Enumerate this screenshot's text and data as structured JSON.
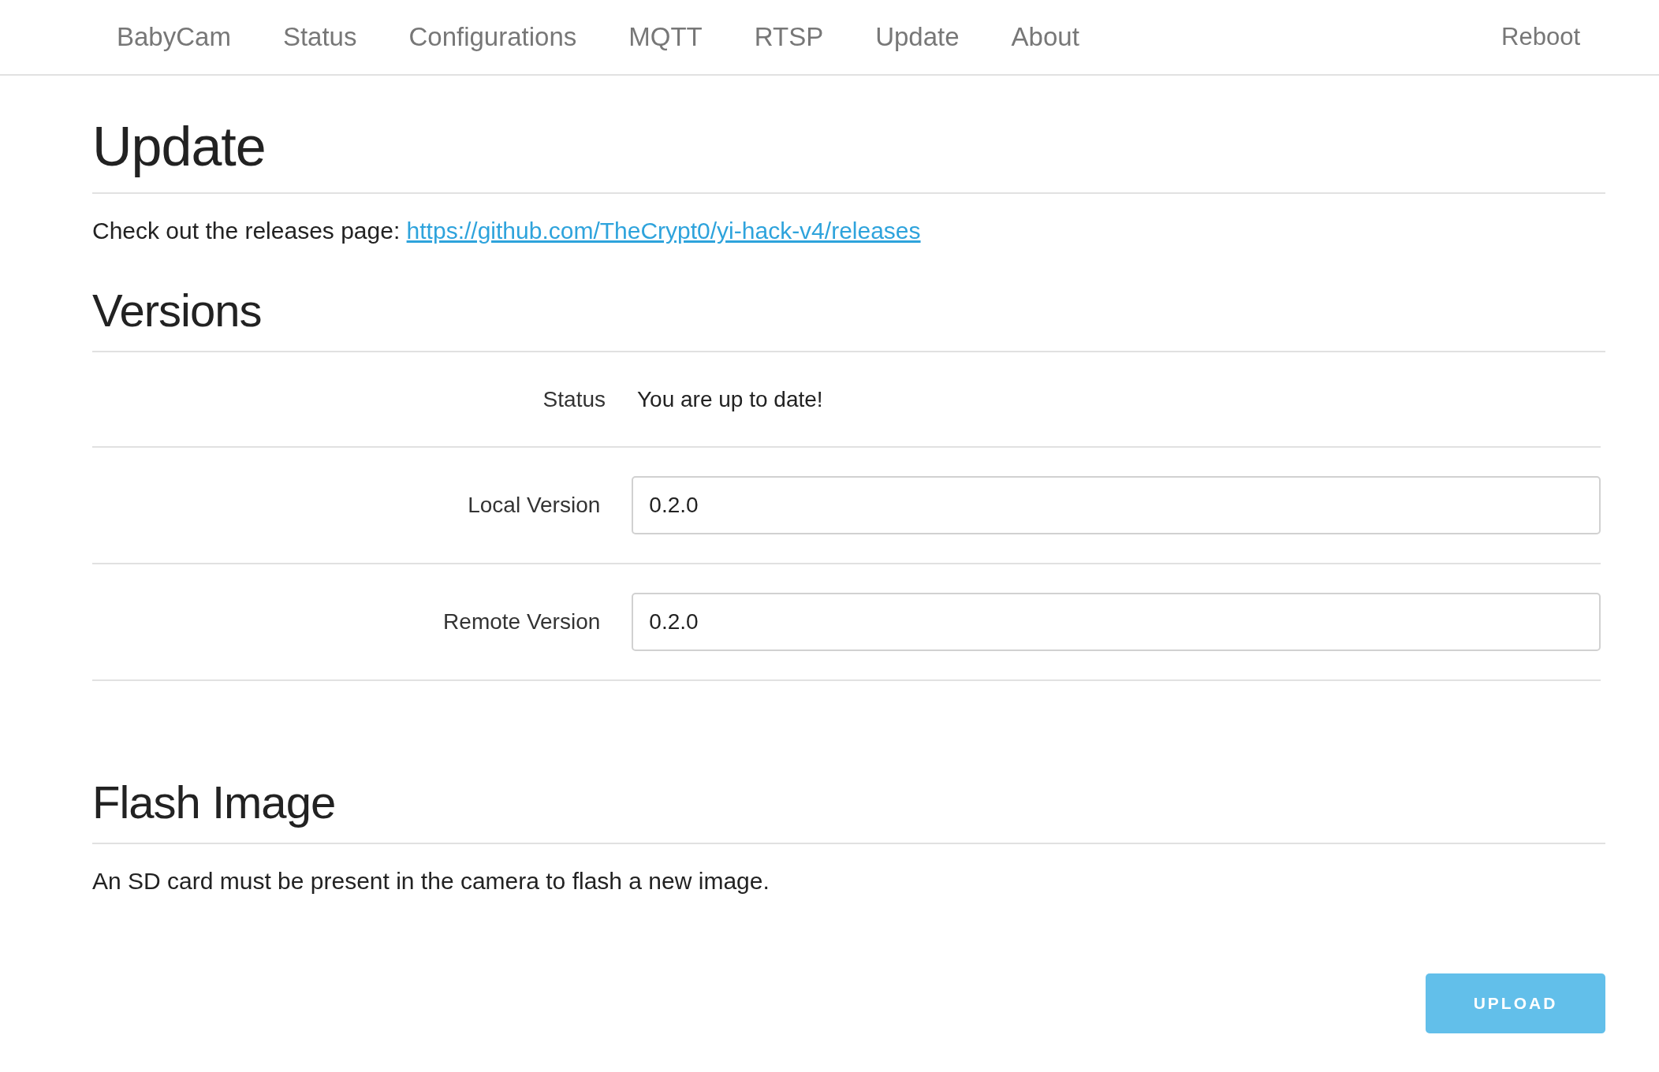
{
  "nav": {
    "items": [
      "BabyCam",
      "Status",
      "Configurations",
      "MQTT",
      "RTSP",
      "Update",
      "About"
    ],
    "right": "Reboot"
  },
  "update": {
    "title": "Update",
    "text": "Check out the releases page: ",
    "link": "https://github.com/TheCrypt0/yi-hack-v4/releases"
  },
  "versions": {
    "title": "Versions",
    "rows": [
      {
        "kind": "text",
        "label": "Status",
        "value": "You are up to date!"
      },
      {
        "kind": "input",
        "label": "Local Version",
        "value": "0.2.0"
      },
      {
        "kind": "input",
        "label": "Remote Version",
        "value": "0.2.0"
      }
    ]
  },
  "flash": {
    "title": "Flash Image",
    "text": "An SD card must be present in the camera to flash a new image.",
    "button": "UPLOAD"
  }
}
